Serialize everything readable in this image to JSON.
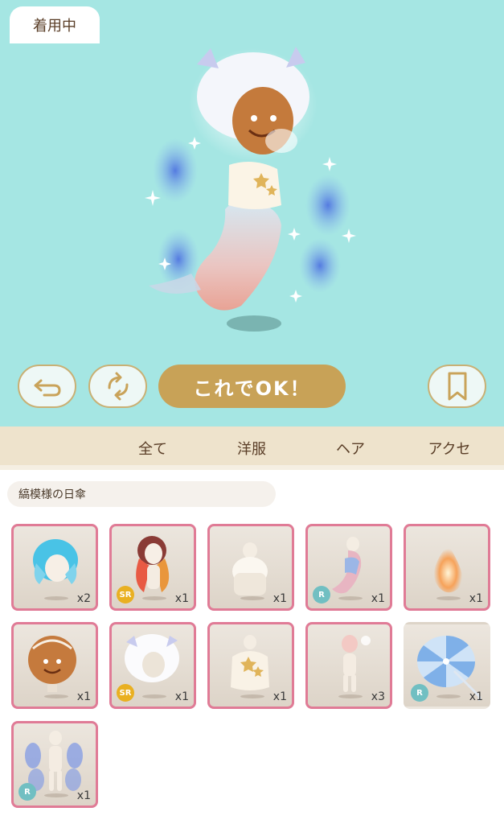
{
  "toolbar": {
    "undo_icon": "undo-arrow-icon",
    "rotate_icon": "rotate-arrows-icon",
    "ok_label": "これでOK！",
    "bookmark_icon": "bookmark-icon"
  },
  "tabs": [
    {
      "label": "着用中",
      "active": true
    },
    {
      "label": "全て",
      "active": false
    },
    {
      "label": "洋服",
      "active": false
    },
    {
      "label": "ヘア",
      "active": false
    },
    {
      "label": "アクセ",
      "active": false
    }
  ],
  "selected_item_name": "縞模様の日傘",
  "items": [
    {
      "name": "blue-hair",
      "qty": "x2",
      "rarity": ""
    },
    {
      "name": "red-hair",
      "qty": "x1",
      "rarity": "SR"
    },
    {
      "name": "white-fur-top",
      "qty": "x1",
      "rarity": ""
    },
    {
      "name": "mermaid-tail",
      "qty": "x1",
      "rarity": "R"
    },
    {
      "name": "flame",
      "qty": "x1",
      "rarity": ""
    },
    {
      "name": "gingerbread-face",
      "qty": "x1",
      "rarity": ""
    },
    {
      "name": "white-fluffy-hair",
      "qty": "x1",
      "rarity": "SR"
    },
    {
      "name": "star-sweater",
      "qty": "x1",
      "rarity": ""
    },
    {
      "name": "pink-puff-body",
      "qty": "x3",
      "rarity": ""
    },
    {
      "name": "striped-parasol",
      "qty": "x1",
      "rarity": "R"
    },
    {
      "name": "blue-sparkle-aura",
      "qty": "x1",
      "rarity": "R"
    }
  ],
  "colors": {
    "stage_bg": "#a5e6e3",
    "ok_button": "#c8a257",
    "tab_bar": "#eee3cc",
    "card_border": "#e07b96",
    "rarity_r": "#71bfc2",
    "rarity_sr": "#e9b021"
  }
}
